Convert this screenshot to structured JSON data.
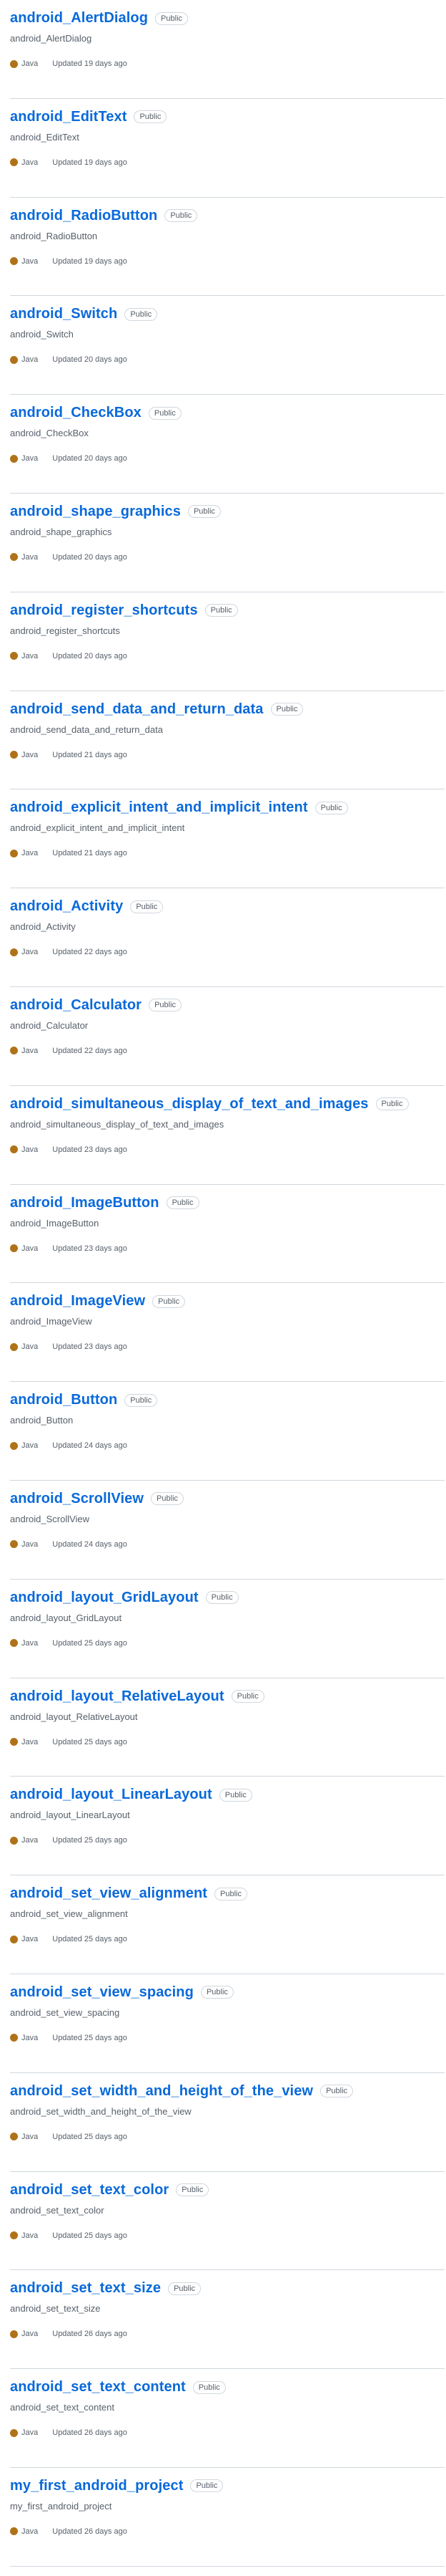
{
  "colors": {
    "link": "#0969da",
    "java": "#b07219",
    "muted": "#57606a",
    "divider": "#d0d7de"
  },
  "repos": [
    {
      "name": "android_AlertDialog",
      "visibility": "Public",
      "description": "android_AlertDialog",
      "language": "Java",
      "updated": "Updated 19 days ago"
    },
    {
      "name": "android_EditText",
      "visibility": "Public",
      "description": "android_EditText",
      "language": "Java",
      "updated": "Updated 19 days ago"
    },
    {
      "name": "android_RadioButton",
      "visibility": "Public",
      "description": "android_RadioButton",
      "language": "Java",
      "updated": "Updated 19 days ago"
    },
    {
      "name": "android_Switch",
      "visibility": "Public",
      "description": "android_Switch",
      "language": "Java",
      "updated": "Updated 20 days ago"
    },
    {
      "name": "android_CheckBox",
      "visibility": "Public",
      "description": "android_CheckBox",
      "language": "Java",
      "updated": "Updated 20 days ago"
    },
    {
      "name": "android_shape_graphics",
      "visibility": "Public",
      "description": "android_shape_graphics",
      "language": "Java",
      "updated": "Updated 20 days ago"
    },
    {
      "name": "android_register_shortcuts",
      "visibility": "Public",
      "description": "android_register_shortcuts",
      "language": "Java",
      "updated": "Updated 20 days ago"
    },
    {
      "name": "android_send_data_and_return_data",
      "visibility": "Public",
      "description": "android_send_data_and_return_data",
      "language": "Java",
      "updated": "Updated 21 days ago"
    },
    {
      "name": "android_explicit_intent_and_implicit_intent",
      "visibility": "Public",
      "description": "android_explicit_intent_and_implicit_intent",
      "language": "Java",
      "updated": "Updated 21 days ago"
    },
    {
      "name": "android_Activity",
      "visibility": "Public",
      "description": "android_Activity",
      "language": "Java",
      "updated": "Updated 22 days ago"
    },
    {
      "name": "android_Calculator",
      "visibility": "Public",
      "description": "android_Calculator",
      "language": "Java",
      "updated": "Updated 22 days ago"
    },
    {
      "name": "android_simultaneous_display_of_text_and_images",
      "visibility": "Public",
      "description": "android_simultaneous_display_of_text_and_images",
      "language": "Java",
      "updated": "Updated 23 days ago"
    },
    {
      "name": "android_ImageButton",
      "visibility": "Public",
      "description": "android_ImageButton",
      "language": "Java",
      "updated": "Updated 23 days ago"
    },
    {
      "name": "android_ImageView",
      "visibility": "Public",
      "description": "android_ImageView",
      "language": "Java",
      "updated": "Updated 23 days ago"
    },
    {
      "name": "android_Button",
      "visibility": "Public",
      "description": "android_Button",
      "language": "Java",
      "updated": "Updated 24 days ago"
    },
    {
      "name": "android_ScrollView",
      "visibility": "Public",
      "description": "android_ScrollView",
      "language": "Java",
      "updated": "Updated 24 days ago"
    },
    {
      "name": "android_layout_GridLayout",
      "visibility": "Public",
      "description": "android_layout_GridLayout",
      "language": "Java",
      "updated": "Updated 25 days ago"
    },
    {
      "name": "android_layout_RelativeLayout",
      "visibility": "Public",
      "description": "android_layout_RelativeLayout",
      "language": "Java",
      "updated": "Updated 25 days ago"
    },
    {
      "name": "android_layout_LinearLayout",
      "visibility": "Public",
      "description": "android_layout_LinearLayout",
      "language": "Java",
      "updated": "Updated 25 days ago"
    },
    {
      "name": "android_set_view_alignment",
      "visibility": "Public",
      "description": "android_set_view_alignment",
      "language": "Java",
      "updated": "Updated 25 days ago"
    },
    {
      "name": "android_set_view_spacing",
      "visibility": "Public",
      "description": "android_set_view_spacing",
      "language": "Java",
      "updated": "Updated 25 days ago"
    },
    {
      "name": "android_set_width_and_height_of_the_view",
      "visibility": "Public",
      "description": "android_set_width_and_height_of_the_view",
      "language": "Java",
      "updated": "Updated 25 days ago"
    },
    {
      "name": "android_set_text_color",
      "visibility": "Public",
      "description": "android_set_text_color",
      "language": "Java",
      "updated": "Updated 25 days ago"
    },
    {
      "name": "android_set_text_size",
      "visibility": "Public",
      "description": "android_set_text_size",
      "language": "Java",
      "updated": "Updated 26 days ago"
    },
    {
      "name": "android_set_text_content",
      "visibility": "Public",
      "description": "android_set_text_content",
      "language": "Java",
      "updated": "Updated 26 days ago"
    },
    {
      "name": "my_first_android_project",
      "visibility": "Public",
      "description": "my_first_android_project",
      "language": "Java",
      "updated": "Updated 26 days ago"
    }
  ]
}
